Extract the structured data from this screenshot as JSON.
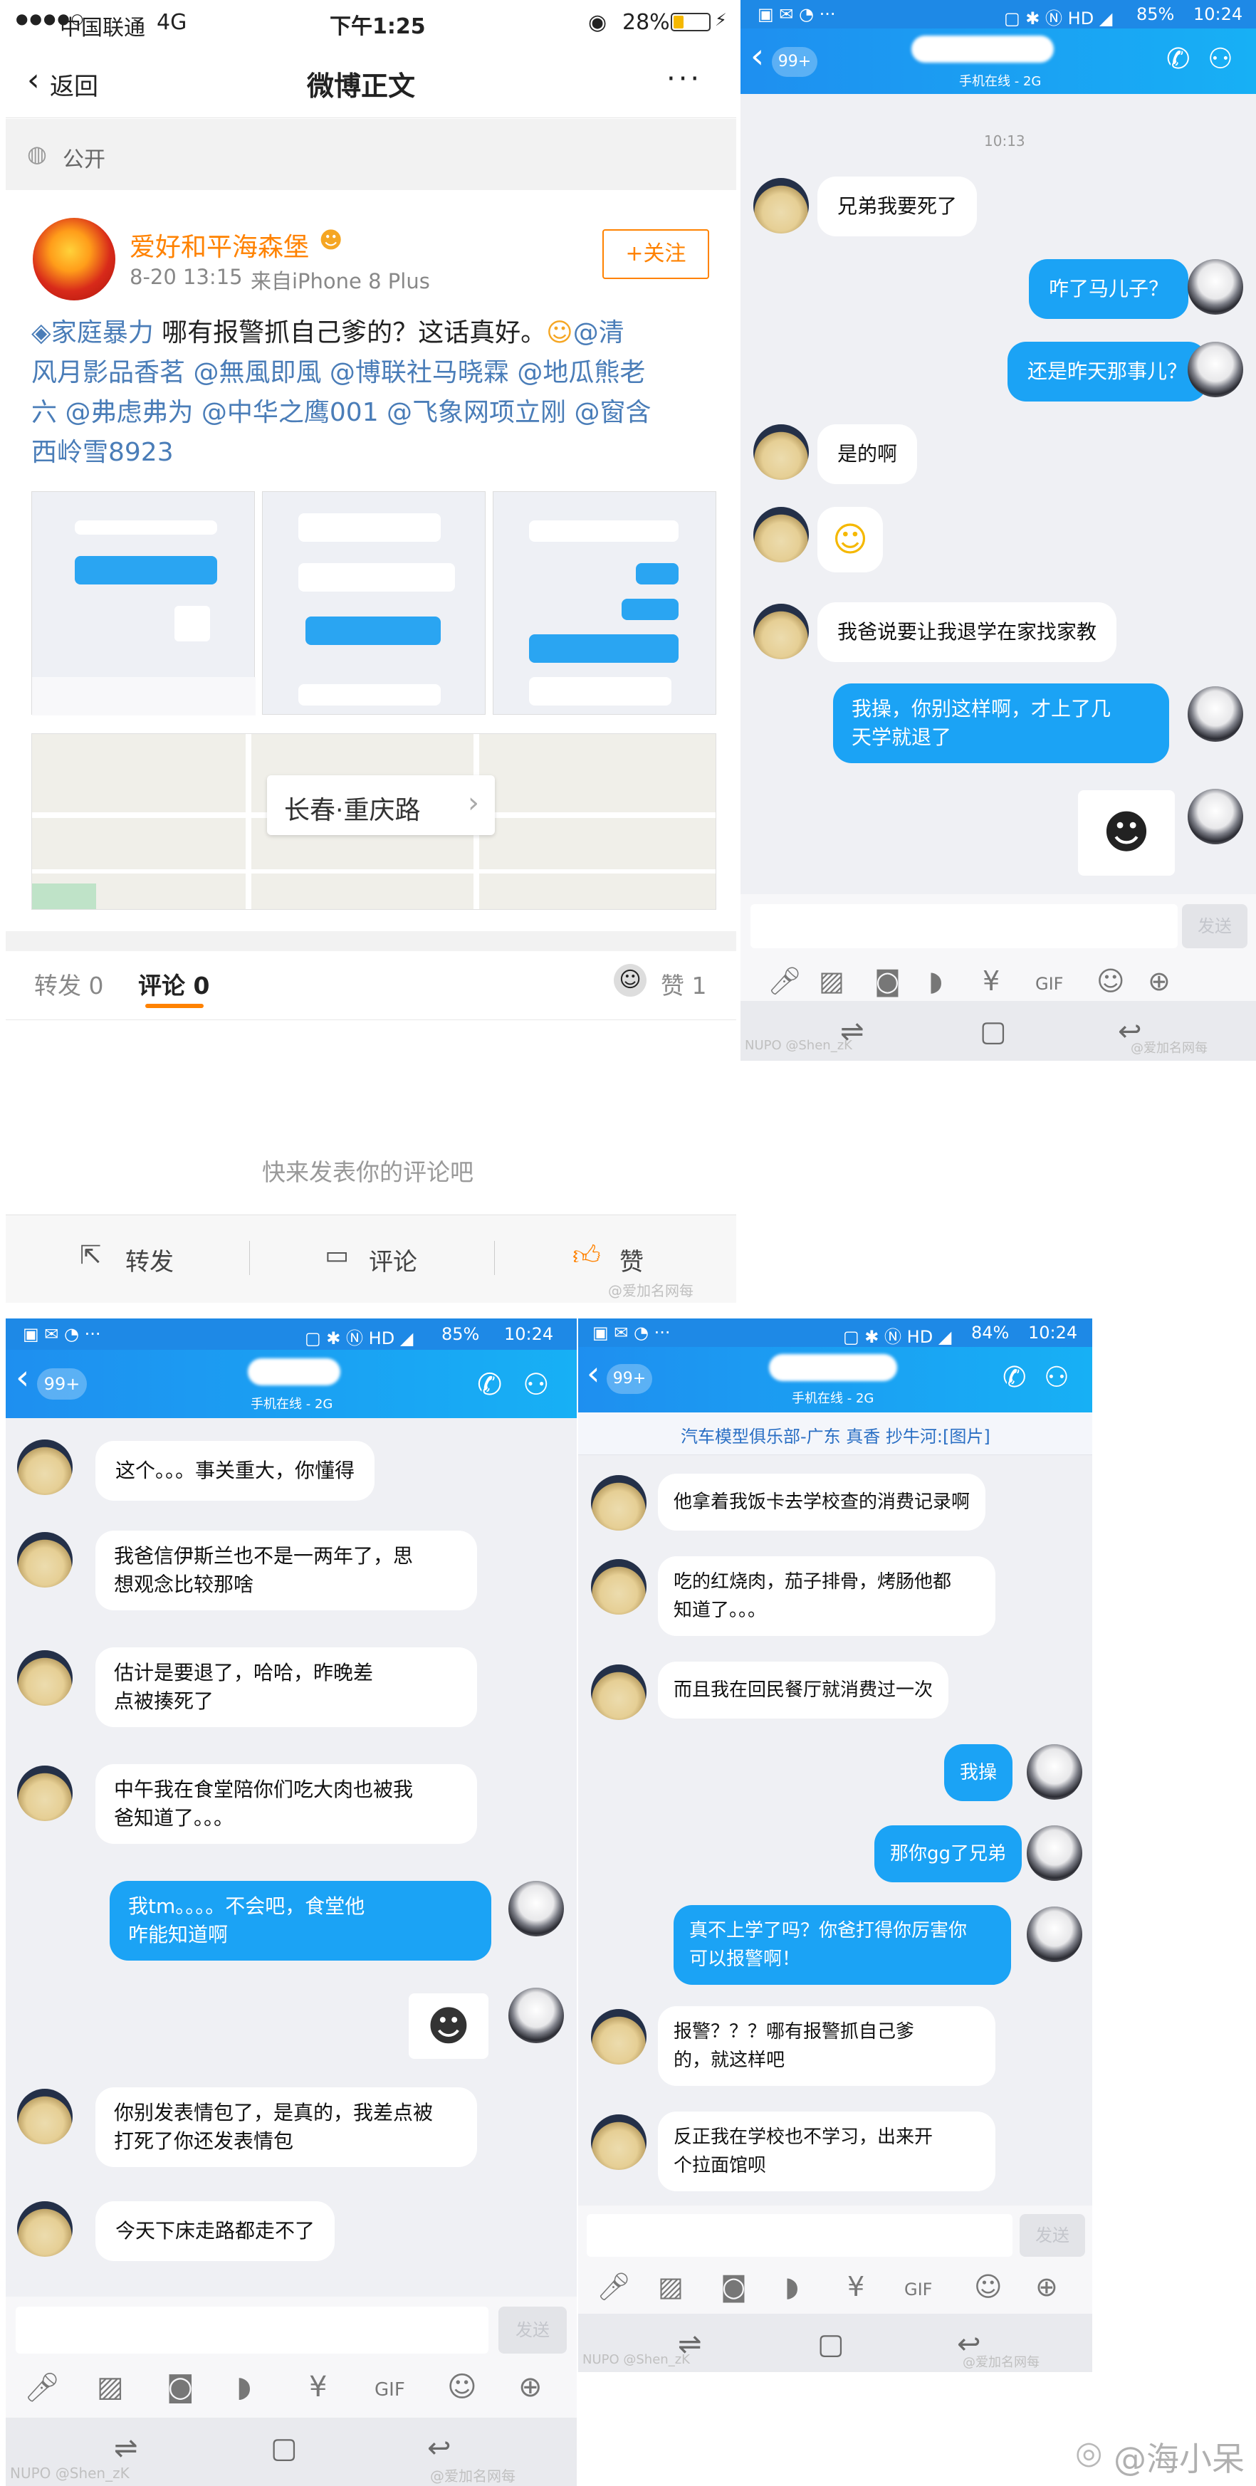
{
  "weibo": {
    "status": {
      "carrier": "中国联通",
      "network": "4G",
      "time": "下午1:25",
      "battery": "28%"
    },
    "nav": {
      "back_label": "返回",
      "title": "微博正文",
      "more": "···"
    },
    "visibility": "公开",
    "post": {
      "author": "爱好和平海森堡",
      "meta_time": "8-20 13:15",
      "meta_source": "来自iPhone 8 Plus",
      "follow_label": "+关注",
      "topic": "家庭暴力",
      "text_line1_rest": " 哪有报警抓自己爹的？这话真好。",
      "mention1": "@清",
      "line2": "风月影品香茗 @無風即風 @博联社马晓霖 @地瓜熊老",
      "line3": "六 @弗虑弗为 @中华之鹰001 @飞象网项立刚 @窗含",
      "line4": "西岭雪8923"
    },
    "location_label": "长春·重庆路",
    "tabs": {
      "repost": "转发 0",
      "comment": "评论 0",
      "like": "赞 1"
    },
    "comment_placeholder": "快来发表你的评论吧",
    "actions": {
      "repost": "转发",
      "comment": "评论",
      "like": "赞"
    },
    "watermark": "@爱加名网每"
  },
  "qq_top": {
    "status": {
      "battery": "85%",
      "time": "10:24"
    },
    "badge": "99+",
    "subtitle": "手机在线 - 2G",
    "timestamp": "10:13",
    "messages": [
      "兄弟我要死了",
      "咋了马儿子？",
      "还是昨天那事儿？",
      "是的啊",
      "我爸说要让我退学在家找家教",
      "我操，你别这样啊，才上了几",
      "天学就退了"
    ],
    "send": "发送",
    "wm_left": "NUPO @Shen_zK",
    "wm_right": "@爱加名网每"
  },
  "qq_bl": {
    "status": {
      "battery": "85%",
      "time": "10:24"
    },
    "badge": "99+",
    "subtitle": "手机在线 - 2G",
    "messages": [
      "这个。。。事关重大，你懂得",
      "我爸信伊斯兰也不是一两年了，思",
      "想观念比较那啥",
      "估计是要退了，哈哈，昨晚差",
      "点被揍死了",
      "中午我在食堂陪你们吃大肉也被我",
      "爸知道了。。。",
      "我tm。。。。不会吧，食堂他",
      "咋能知道啊",
      "你别发表情包了，是真的，我差点被",
      "打死了你还发表情包",
      "今天下床走路都走不了"
    ],
    "send": "发送",
    "wm_left": "NUPO @Shen_zK",
    "wm_right": "@爱加名网每"
  },
  "qq_br": {
    "status": {
      "battery": "84%",
      "time": "10:24"
    },
    "badge": "99+",
    "subtitle": "手机在线 - 2G",
    "banner": "汽车模型俱乐部-广东 真香 抄牛河:[图片]",
    "messages": [
      "他拿着我饭卡去学校查的消费记录啊",
      "吃的红烧肉，茄子排骨，烤肠他都",
      "知道了。。。",
      "而且我在回民餐厅就消费过一次",
      "我操",
      "那你gg了兄弟",
      "真不上学了吗？你爸打得你厉害你",
      "可以报警啊！",
      "报警？？？哪有报警抓自己爹",
      "的，就这样吧",
      "反正我在学校也不学习，出来开",
      "个拉面馆呗"
    ],
    "send": "发送",
    "wm_left": "NUPO @Shen_zK",
    "wm_right": "@爱加名网每"
  },
  "corner_watermark": "@海小呆",
  "colors": {
    "weibo_orange": "#ff8200",
    "qq_blue": "#1ba3f5",
    "link_blue": "#4a7db8"
  }
}
